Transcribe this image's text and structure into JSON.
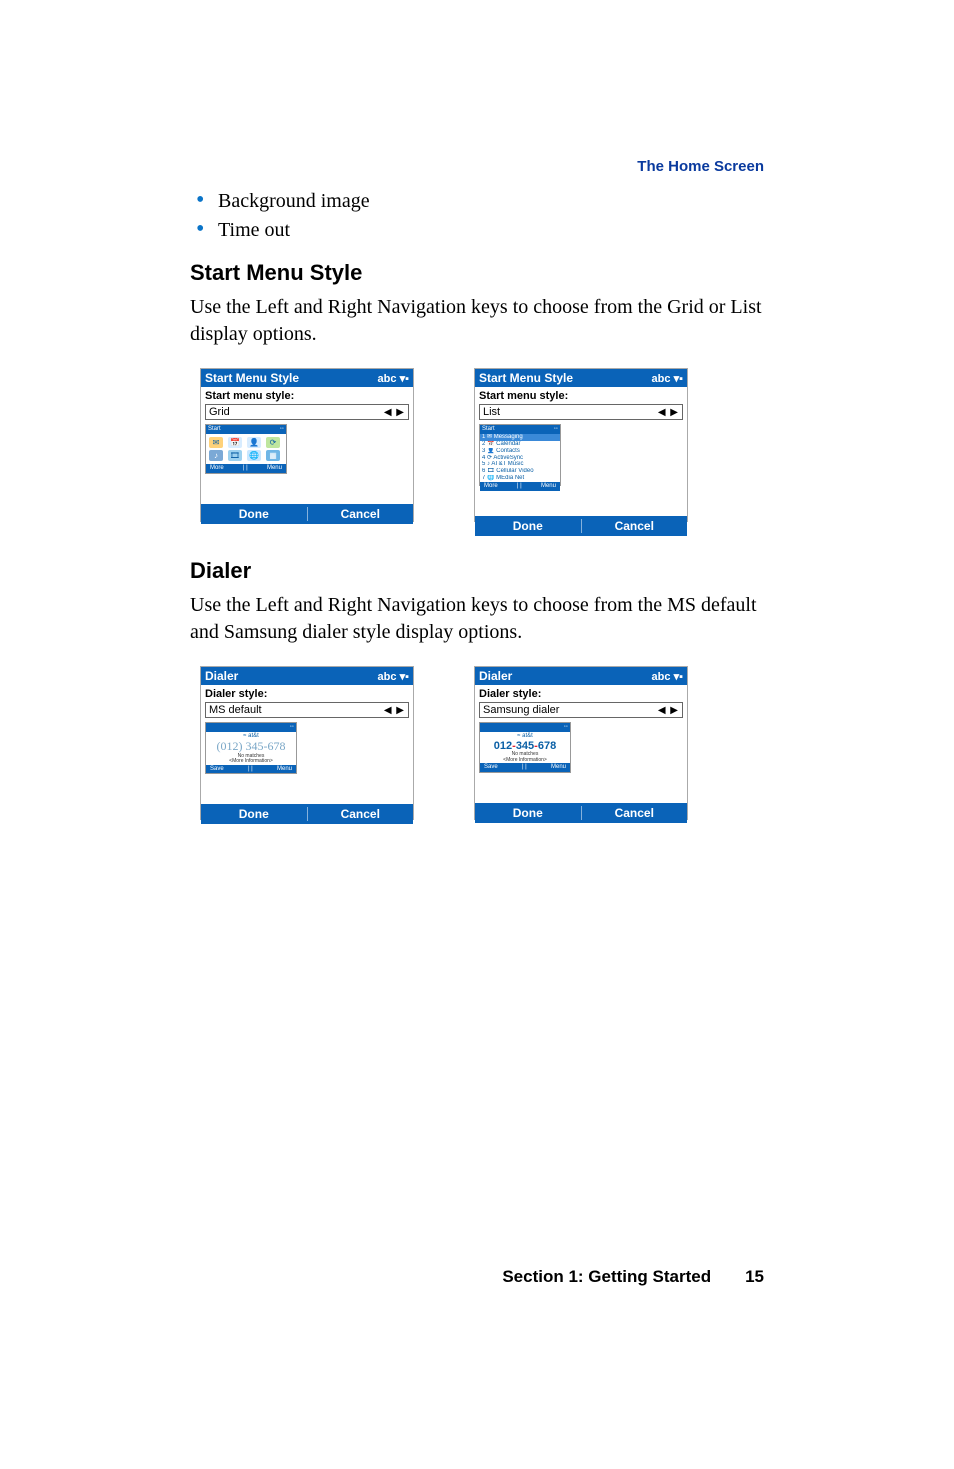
{
  "header": {
    "link": "The Home Screen"
  },
  "bullets": [
    "Background image",
    "Time out"
  ],
  "sections": {
    "startMenu": {
      "heading": "Start Menu Style",
      "body": "Use the Left and Right Navigation keys to choose from the Grid or List display options."
    },
    "dialer": {
      "heading": "Dialer",
      "body": "Use the Left and Right Navigation keys to choose from the MS default and Samsung dialer style display options."
    }
  },
  "phones": {
    "abc": "abc",
    "done": "Done",
    "cancel": "Cancel",
    "arrows": "◀ ▶",
    "miniSoftMore": "More",
    "miniSoftMenu": "Menu",
    "miniSoftSave": "Save",
    "startTitle": "Start Menu Style",
    "startLabel": "Start menu style:",
    "gridValue": "Grid",
    "listValue": "List",
    "miniStart": "Start",
    "listItems": [
      "Messaging",
      "Calendar",
      "Contacts",
      "ActiveSync",
      "AT&T Music",
      "Cellular Video",
      "MEdia Net"
    ],
    "dialerTitle": "Dialer",
    "dialerLabel": "Dialer style:",
    "msValue": "MS default",
    "samsungValue": "Samsung dialer",
    "carrier": "at&t",
    "telMs": "(012) 345-678",
    "telSmA": "012",
    "telSmB": "345",
    "telSmC": "678",
    "noMatches": "No matches",
    "moreInfo": "<More Information>"
  },
  "footer": {
    "section": "Section 1: Getting Started",
    "page": "15"
  }
}
